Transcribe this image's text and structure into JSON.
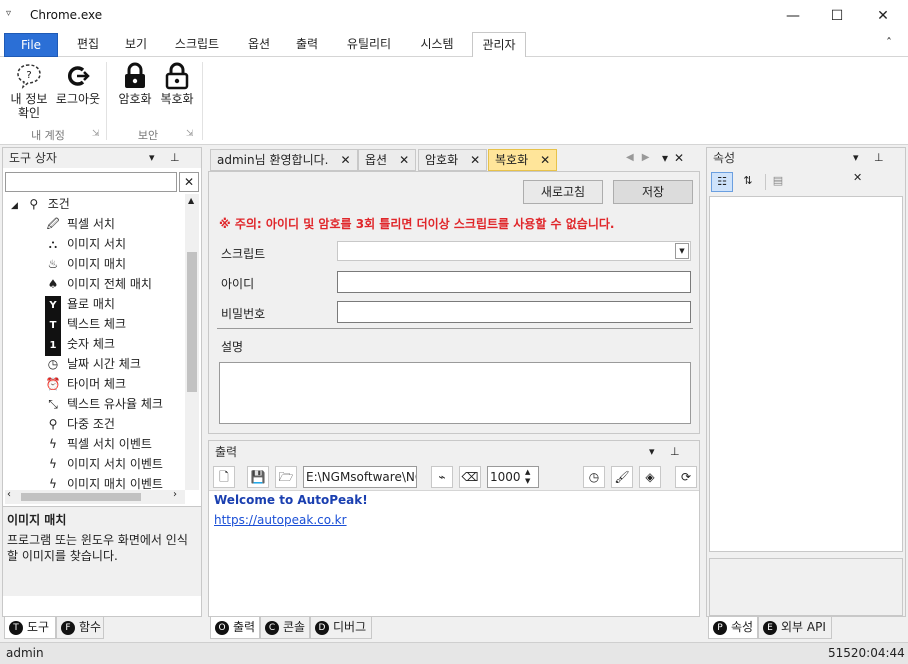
{
  "window": {
    "title": "Chrome.exe",
    "min": "—",
    "max": "☐",
    "close": "✕",
    "sysmenu": "▿"
  },
  "menu": {
    "file": "File",
    "items": [
      "편집",
      "보기",
      "스크립트",
      "옵션",
      "출력",
      "유틸리티",
      "시스템",
      "관리자"
    ],
    "collapse": "ˆ"
  },
  "ribbon": {
    "account_group": "내 계정",
    "security_group": "보안",
    "buttons": {
      "myinfo_line1": "내 정보",
      "myinfo_line2": "확인",
      "logout": "로그아웃",
      "encrypt": "암호화",
      "decrypt": "복호화"
    }
  },
  "toolbox": {
    "title": "도구 상자",
    "search_value": "",
    "root": "조건",
    "items": [
      "픽셀 서치",
      "이미지 서치",
      "이미지 매치",
      "이미지 전체 매치",
      "욜로 매치",
      "텍스트 체크",
      "숫자 체크",
      "날짜 시간 체크",
      "타이머 체크",
      "텍스트 유사율 체크",
      "다중 조건",
      "픽셀 서치 이벤트",
      "이미지 서치 이벤트",
      "이미지 매치 이벤트"
    ],
    "desc_title": "이미지 매치",
    "desc_text": "프로그램 또는 윈도우 화면에서 인식할 이미지를 찾습니다.",
    "tabs": {
      "tool": "도구",
      "func": "함수",
      "tool_key": "T",
      "func_key": "F"
    }
  },
  "doc_tabs": [
    "admin님 환영합니다.",
    "옵션",
    "암호화",
    "복호화"
  ],
  "form": {
    "refresh": "새로고침",
    "save": "저장",
    "warning": "※ 주의: 아이디 및 암호를 3회 틀리면 더이상 스크립트를 사용할 수 없습니다.",
    "script_label": "스크립트",
    "id_label": "아이디",
    "pw_label": "비밀번호",
    "desc_label": "설명",
    "script_value": "",
    "id_value": "",
    "pw_value": "",
    "desc_value": ""
  },
  "output": {
    "title": "출력",
    "path_value": "E:\\NGMsoftware\\NG",
    "number_value": "1000",
    "line1": "Welcome to AutoPeak!",
    "line2": "https://autopeak.co.kr",
    "tabs": {
      "out": "출력",
      "console": "콘솔",
      "debug": "디버그",
      "out_key": "O",
      "console_key": "C",
      "debug_key": "D"
    }
  },
  "props": {
    "title": "속성",
    "tabs": {
      "props": "속성",
      "api": "외부 API",
      "props_key": "P",
      "api_key": "E"
    }
  },
  "status": {
    "user": "admin",
    "time": "51520:04:44"
  },
  "colors": {
    "file_blue": "#2b6fd6",
    "warn_red": "#e0262a",
    "active_tab": "#ffe59a",
    "link_blue": "#1a4fd6"
  }
}
